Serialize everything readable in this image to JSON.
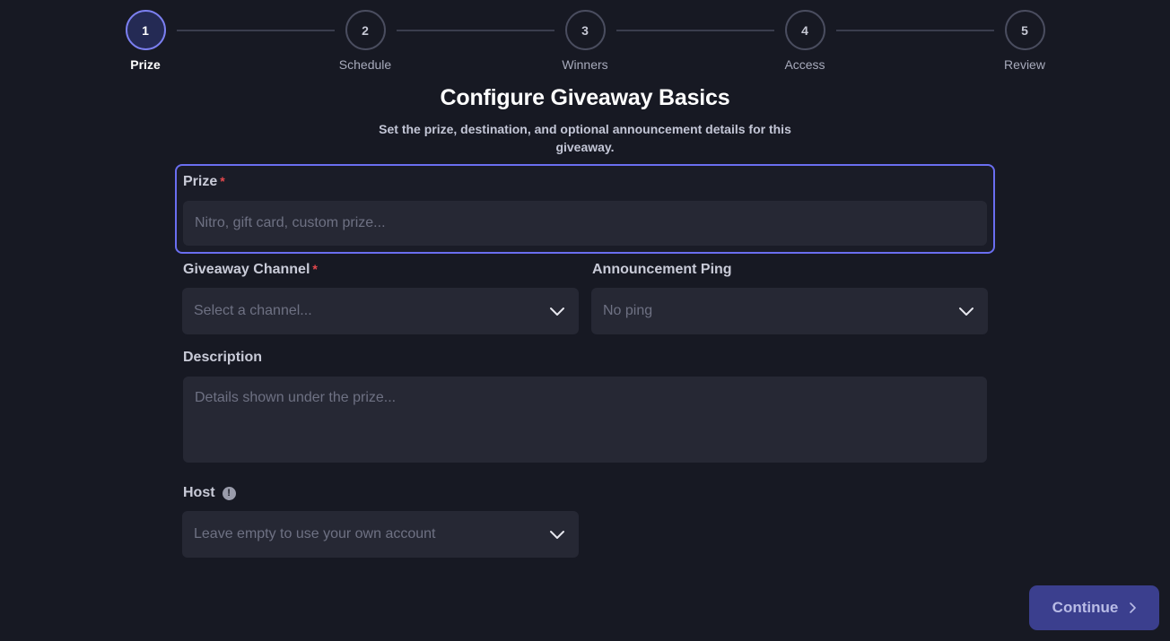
{
  "stepper": {
    "steps": [
      {
        "number": "1",
        "label": "Prize",
        "active": true
      },
      {
        "number": "2",
        "label": "Schedule",
        "active": false
      },
      {
        "number": "3",
        "label": "Winners",
        "active": false
      },
      {
        "number": "4",
        "label": "Access",
        "active": false
      },
      {
        "number": "5",
        "label": "Review",
        "active": false
      }
    ]
  },
  "header": {
    "title": "Configure Giveaway Basics",
    "subtitle": "Set the prize, destination, and optional announcement details for this giveaway."
  },
  "form": {
    "prize": {
      "label": "Prize",
      "required_mark": "*",
      "placeholder": "Nitro, gift card, custom prize..."
    },
    "channel": {
      "label": "Giveaway Channel",
      "required_mark": "*",
      "placeholder": "Select a channel..."
    },
    "ping": {
      "label": "Announcement Ping",
      "placeholder": "No ping"
    },
    "description": {
      "label": "Description",
      "placeholder": "Details shown under the prize..."
    },
    "host": {
      "label": "Host",
      "info_icon": "!",
      "placeholder": "Leave empty to use your own account"
    }
  },
  "footer": {
    "continue_label": "Continue",
    "continue_icon": "chevron-right"
  },
  "colors": {
    "background": "#171923",
    "accent": "#6a6ef0",
    "input_bg": "#262834",
    "required": "#e5484d",
    "button_bg": "#3b3f8e"
  }
}
